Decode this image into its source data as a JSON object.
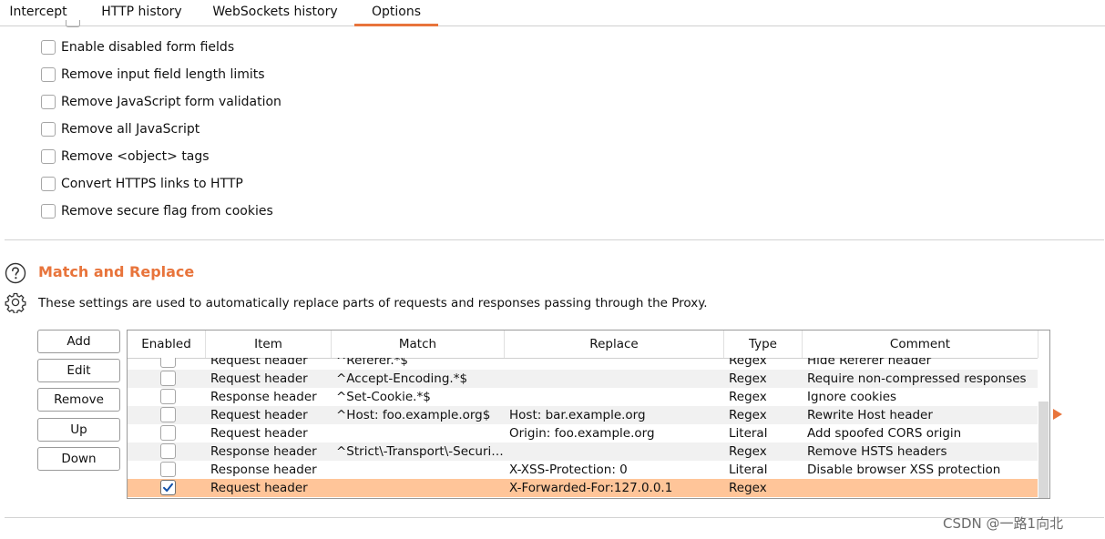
{
  "tabs": [
    "Intercept",
    "HTTP history",
    "WebSockets history",
    "Options"
  ],
  "active_tab": "Options",
  "options": [
    {
      "label": "Enable disabled form fields",
      "checked": false
    },
    {
      "label": "Remove input field length limits",
      "checked": false
    },
    {
      "label": "Remove JavaScript form validation",
      "checked": false
    },
    {
      "label": "Remove all JavaScript",
      "checked": false
    },
    {
      "label": "Remove <object> tags",
      "checked": false
    },
    {
      "label": "Convert HTTPS links to HTTP",
      "checked": false
    },
    {
      "label": "Remove secure flag from cookies",
      "checked": false
    }
  ],
  "section": {
    "title": "Match and Replace",
    "description": "These settings are used to automatically replace parts of requests and responses passing through the Proxy.",
    "help_icon": "question-circle-icon",
    "settings_icon": "gear-icon"
  },
  "buttons": {
    "add": "Add",
    "edit": "Edit",
    "remove": "Remove",
    "up": "Up",
    "down": "Down"
  },
  "table": {
    "columns": [
      "Enabled",
      "Item",
      "Match",
      "Replace",
      "Type",
      "Comment"
    ],
    "rows": [
      {
        "enabled": false,
        "item": "Request header",
        "match": "^Referer.*$",
        "replace": "",
        "type": "Regex",
        "comment": "Hide Referer header"
      },
      {
        "enabled": false,
        "item": "Request header",
        "match": "^Accept-Encoding.*$",
        "replace": "",
        "type": "Regex",
        "comment": "Require non-compressed responses"
      },
      {
        "enabled": false,
        "item": "Response header",
        "match": "^Set-Cookie.*$",
        "replace": "",
        "type": "Regex",
        "comment": "Ignore cookies"
      },
      {
        "enabled": false,
        "item": "Request header",
        "match": "^Host: foo.example.org$",
        "replace": "Host: bar.example.org",
        "type": "Regex",
        "comment": "Rewrite Host header"
      },
      {
        "enabled": false,
        "item": "Request header",
        "match": "",
        "replace": "Origin: foo.example.org",
        "type": "Literal",
        "comment": "Add spoofed CORS origin"
      },
      {
        "enabled": false,
        "item": "Response header",
        "match": "^Strict\\-Transport\\-Securi…",
        "replace": "",
        "type": "Regex",
        "comment": "Remove HSTS headers"
      },
      {
        "enabled": false,
        "item": "Response header",
        "match": "",
        "replace": "X-XSS-Protection: 0",
        "type": "Literal",
        "comment": "Disable browser XSS protection"
      },
      {
        "enabled": true,
        "item": "Request header",
        "match": "",
        "replace": "X-Forwarded-For:127.0.0.1",
        "type": "Regex",
        "comment": ""
      }
    ],
    "selected_row": 7
  },
  "colors": {
    "accent": "#e8743b",
    "selected_row": "#ffc599",
    "alt_row": "#f1f1f1"
  },
  "watermark": "CSDN @一路1向北"
}
